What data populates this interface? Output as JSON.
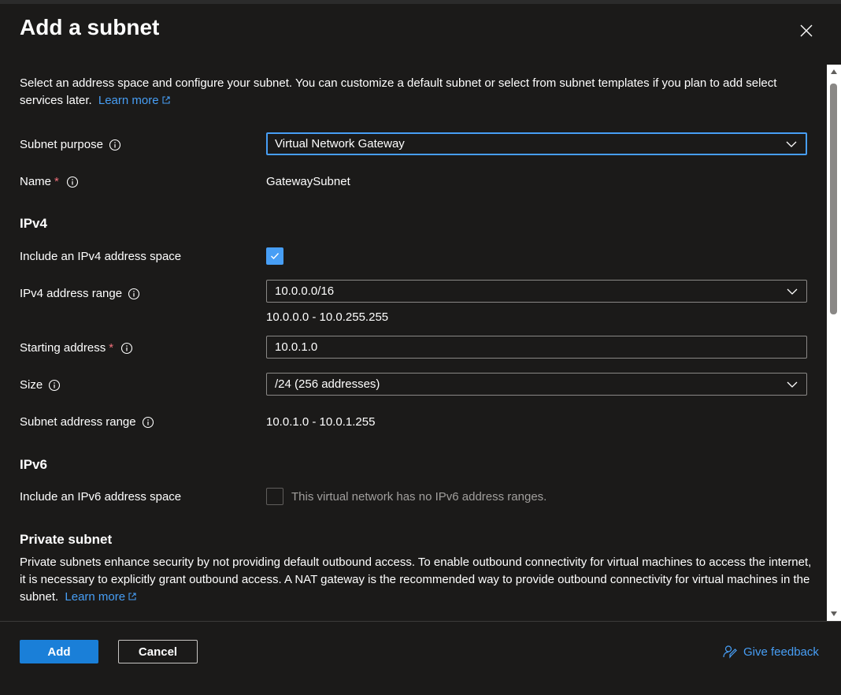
{
  "panel": {
    "title": "Add a subnet",
    "intro_text": "Select an address space and configure your subnet. You can customize a default subnet or select from subnet templates if you plan to add select services later.",
    "intro_link": "Learn more"
  },
  "form": {
    "subnet_purpose": {
      "label": "Subnet purpose",
      "value": "Virtual Network Gateway"
    },
    "name": {
      "label": "Name",
      "required_mark": "*",
      "value": "GatewaySubnet"
    },
    "ipv4": {
      "heading": "IPv4",
      "include_label": "Include an IPv4 address space",
      "include_checked": true,
      "range_label": "IPv4 address range",
      "range_value": "10.0.0.0/16",
      "range_hint": "10.0.0.0 - 10.0.255.255",
      "starting_label": "Starting address",
      "starting_required": "*",
      "starting_value": "10.0.1.0",
      "size_label": "Size",
      "size_value": "/24 (256 addresses)",
      "subnet_range_label": "Subnet address range",
      "subnet_range_value": "10.0.1.0 - 10.0.1.255"
    },
    "ipv6": {
      "heading": "IPv6",
      "include_label": "Include an IPv6 address space",
      "include_checked": false,
      "disabled_note": "This virtual network has no IPv6 address ranges."
    },
    "private_subnet": {
      "heading": "Private subnet",
      "description": "Private subnets enhance security by not providing default outbound access. To enable outbound connectivity for virtual machines to access the internet, it is necessary to explicitly grant outbound access. A NAT gateway is the recommended way to provide outbound connectivity for virtual machines in the subnet.",
      "link": "Learn more"
    }
  },
  "footer": {
    "add_label": "Add",
    "cancel_label": "Cancel",
    "feedback_label": "Give feedback"
  },
  "icons": {
    "close": "close-icon",
    "info": "info-icon",
    "external": "external-link-icon",
    "chevron": "chevron-down-icon",
    "check": "checkmark-icon",
    "feedback": "feedback-icon"
  },
  "colors": {
    "background": "#1b1a19",
    "accent": "#479ef5",
    "primary_button": "#1a7fd8",
    "required": "#f1707b"
  }
}
